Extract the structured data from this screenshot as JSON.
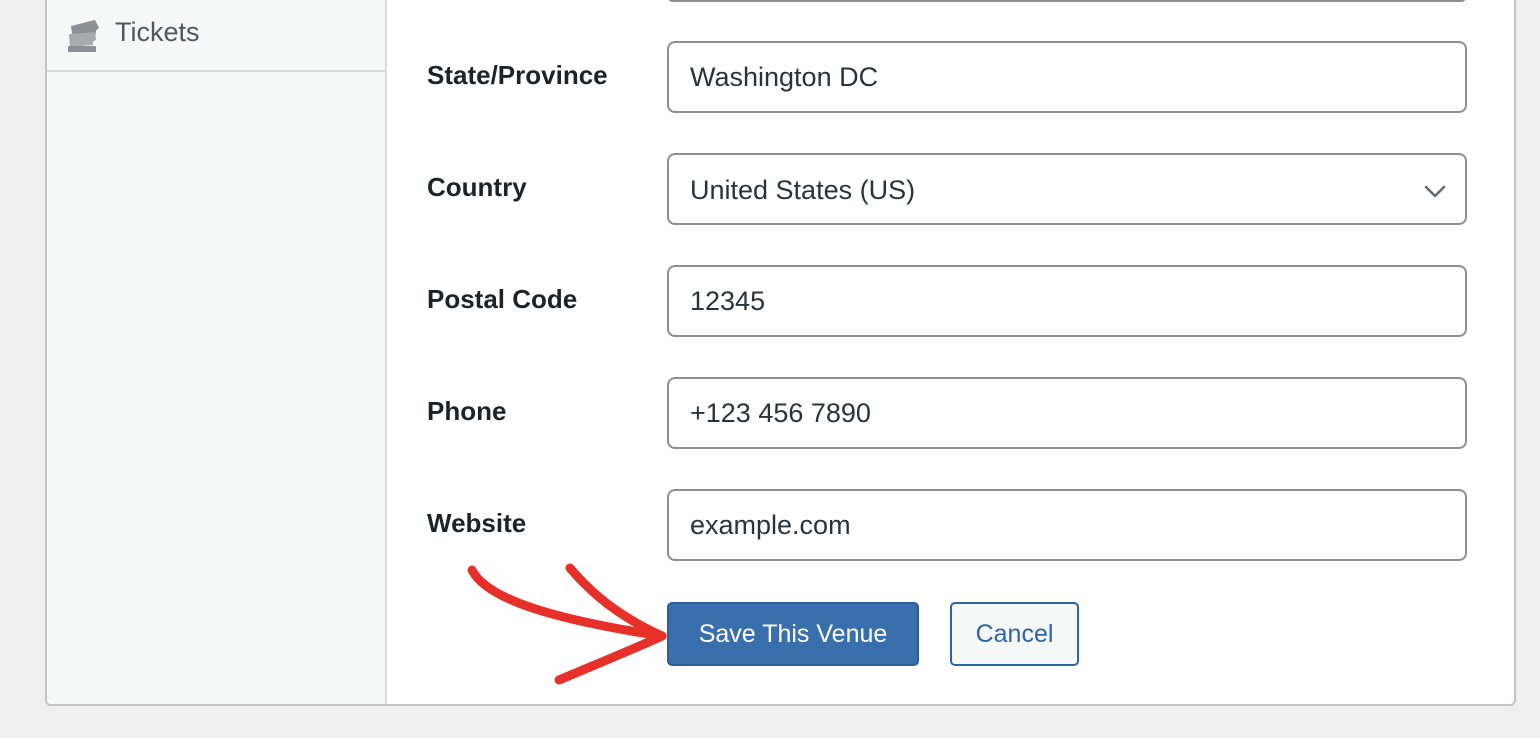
{
  "sidebar": {
    "items": [
      {
        "label": "Tickets",
        "icon": "tickets-icon"
      }
    ]
  },
  "form": {
    "state": {
      "label": "State/Province",
      "value": "Washington DC"
    },
    "country": {
      "label": "Country",
      "value": "United States (US)"
    },
    "postal": {
      "label": "Postal Code",
      "value": "12345"
    },
    "phone": {
      "label": "Phone",
      "value": "+123 456 7890"
    },
    "website": {
      "label": "Website",
      "value": "example.com"
    }
  },
  "actions": {
    "save_label": "Save This Venue",
    "cancel_label": "Cancel"
  },
  "colors": {
    "primary": "#3a6fae",
    "link": "#2c64a6",
    "annotation_arrow": "#e8302a"
  }
}
